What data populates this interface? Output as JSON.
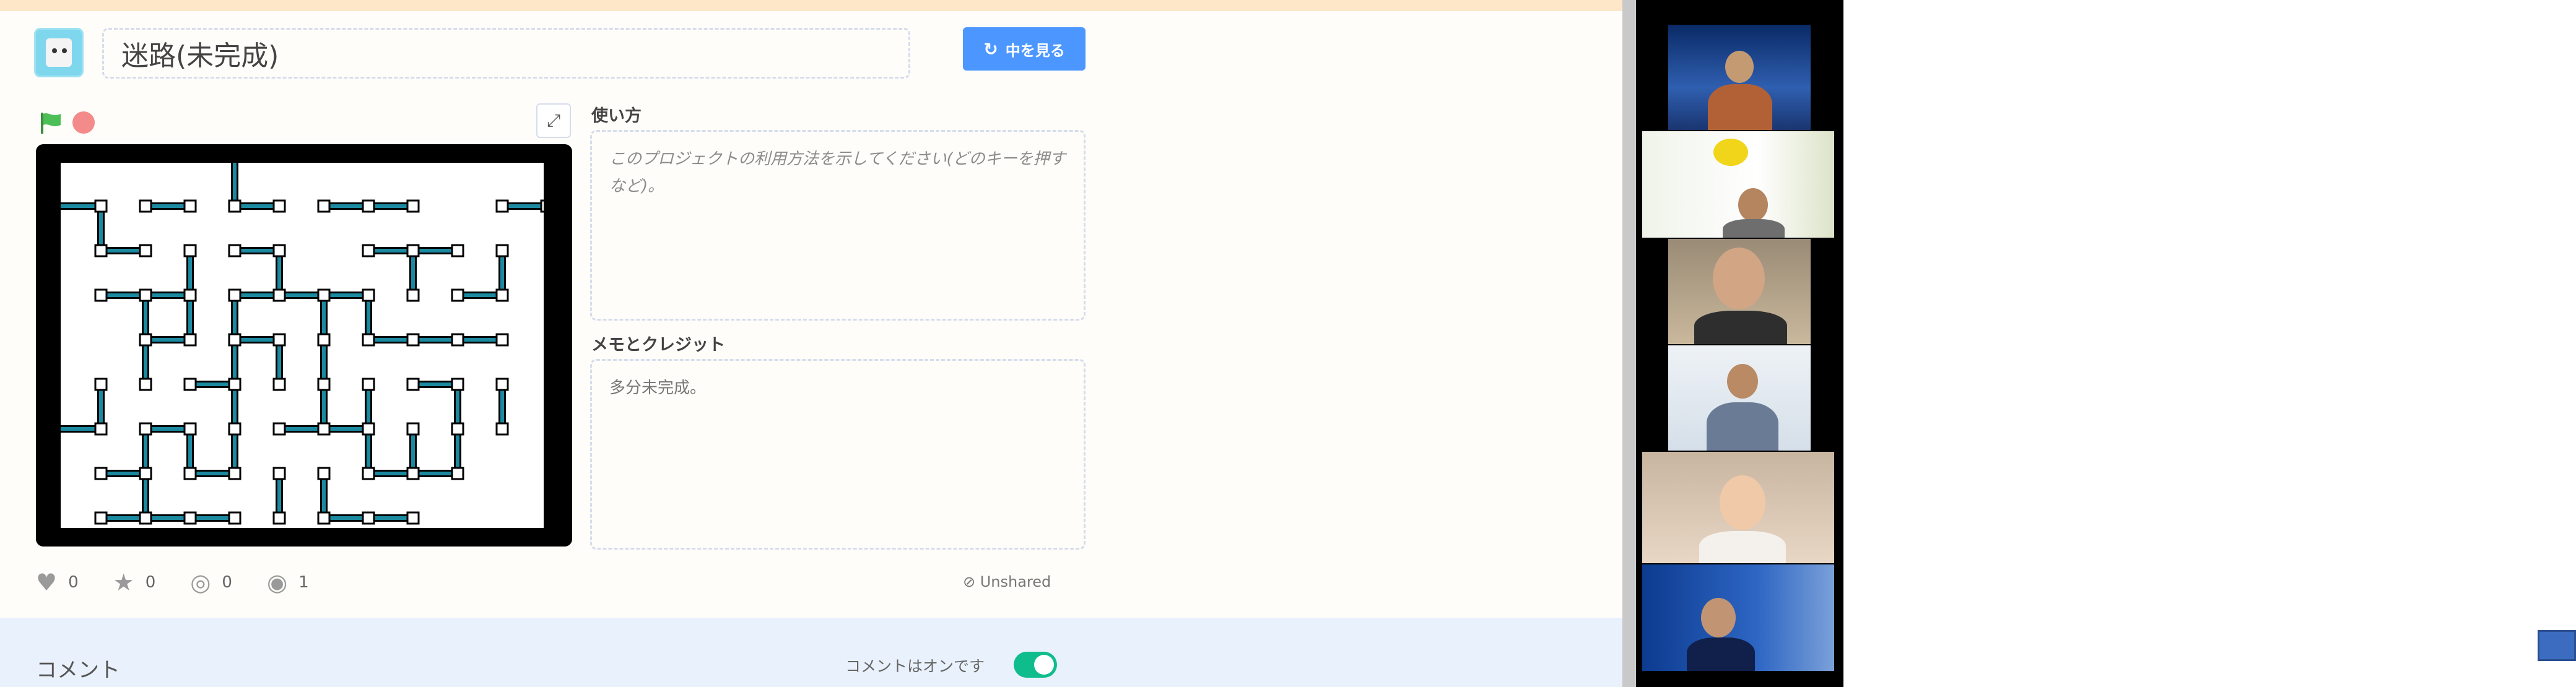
{
  "project": {
    "title": "迷路(未完成)",
    "see_inside_label": "中を見る",
    "see_inside_icon": "sync-icon"
  },
  "instructions": {
    "label": "使い方",
    "placeholder": "このプロジェクトの利用方法を示してください(どのキーを押すなど)。"
  },
  "notes": {
    "label": "メモとクレジット",
    "value": "多分未完成。"
  },
  "stats": {
    "loves": "0",
    "favorites": "0",
    "remixes": "0",
    "views": "1",
    "share_status": "⊘ Unshared"
  },
  "comments": {
    "title": "コメント",
    "status": "コメントはオンです",
    "enabled": true
  },
  "colors": {
    "accent_blue": "#4c97ff",
    "toggle_green": "#0fbd8c",
    "maze_wall": "#1b8aa0"
  },
  "video_call": {
    "participant_count": 6
  }
}
